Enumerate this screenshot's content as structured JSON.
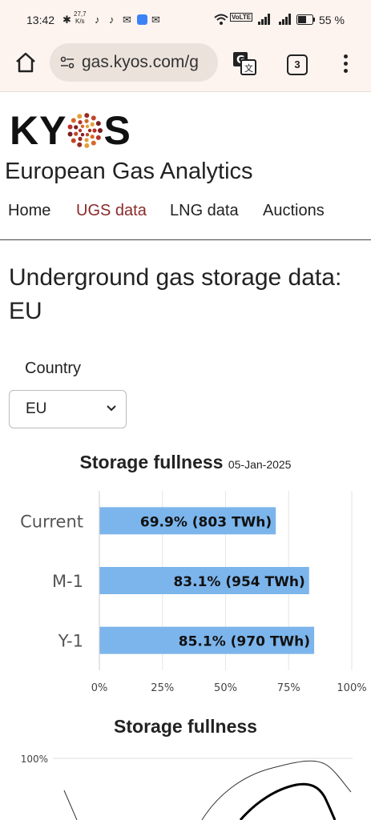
{
  "status_bar": {
    "time": "13:42",
    "net_speed_value": "27,7",
    "net_speed_unit": "K/s",
    "battery_percent": "55 %"
  },
  "browser": {
    "url": "gas.kyos.com/g",
    "tab_count": "3"
  },
  "site": {
    "logo_text_left": "KY",
    "logo_text_right": "S",
    "title": "European Gas Analytics",
    "nav": [
      {
        "label": "Home",
        "active": false
      },
      {
        "label": "UGS data",
        "active": true
      },
      {
        "label": "LNG data",
        "active": false
      },
      {
        "label": "Auctions",
        "active": false
      }
    ]
  },
  "page": {
    "title": "Underground gas storage data: EU",
    "country_label": "Country",
    "country_selected": "EU"
  },
  "chart_data": [
    {
      "type": "bar",
      "orientation": "horizontal",
      "title": "Storage fullness",
      "subtitle": "05-Jan-2025",
      "categories": [
        "Current",
        "M-1",
        "Y-1"
      ],
      "values": [
        69.9,
        83.1,
        85.1
      ],
      "data_labels": [
        "69.9% (803 TWh)",
        "83.1% (954 TWh)",
        "85.1% (970 TWh)"
      ],
      "xlim": [
        0,
        100
      ],
      "x_ticks": [
        "0%",
        "25%",
        "50%",
        "75%",
        "100%"
      ],
      "bar_color": "#7cb5ec",
      "grid": true
    },
    {
      "type": "line",
      "title": "Storage fullness",
      "y_ticks": [
        "100%"
      ]
    }
  ]
}
